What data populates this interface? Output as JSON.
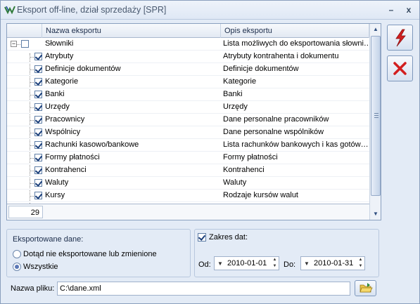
{
  "window": {
    "title": "Eksport off-line, dział sprzedaży [SPR]",
    "minimize_glyph": "–",
    "close_glyph": "x"
  },
  "grid": {
    "columns": [
      "Nazwa eksportu",
      "Opis eksportu"
    ],
    "root": {
      "name": "Słowniki",
      "description": "Lista możliwych do eksportowania słowni…",
      "checked": false,
      "expanded": true
    },
    "rows": [
      {
        "name": "Atrybuty",
        "description": "Atrybuty kontrahenta i dokumentu",
        "checked": true
      },
      {
        "name": "Definicje dokumentów",
        "description": "Definicje dokumentów",
        "checked": true
      },
      {
        "name": "Kategorie",
        "description": "Kategorie",
        "checked": true
      },
      {
        "name": "Banki",
        "description": "Banki",
        "checked": true
      },
      {
        "name": "Urzędy",
        "description": "Urzędy",
        "checked": true
      },
      {
        "name": "Pracownicy",
        "description": "Dane personalne pracowników",
        "checked": true
      },
      {
        "name": "Wspólnicy",
        "description": "Dane personalne wspólników",
        "checked": true
      },
      {
        "name": "Rachunki kasowo/bankowe",
        "description": "Lista rachunków bankowych i kas gotów…",
        "checked": true
      },
      {
        "name": "Formy płatności",
        "description": "Formy płatności",
        "checked": true
      },
      {
        "name": "Kontrahenci",
        "description": "Kontrahenci",
        "checked": true
      },
      {
        "name": "Waluty",
        "description": "Waluty",
        "checked": true
      },
      {
        "name": "Kursy",
        "description": "Rodzaje kursów walut",
        "checked": true
      }
    ],
    "count": "29"
  },
  "side_buttons": {
    "export_icon": "lightning-icon",
    "cancel_icon": "red-x-icon"
  },
  "exported_data": {
    "title": "Eksportowane dane:",
    "options": [
      "Dotąd nie eksportowane lub zmienione",
      "Wszystkie"
    ],
    "selected_index": 1
  },
  "date_range": {
    "label": "Zakres dat:",
    "checked": true,
    "from_label": "Od:",
    "from_value": "2010-01-01",
    "to_label": "Do:",
    "to_value": "2010-01-31"
  },
  "file": {
    "label": "Nazwa pliku:",
    "value": "C:\\dane.xml"
  },
  "colors": {
    "accent_red": "#d21f1f",
    "window_bg": "#e3ebf6"
  }
}
